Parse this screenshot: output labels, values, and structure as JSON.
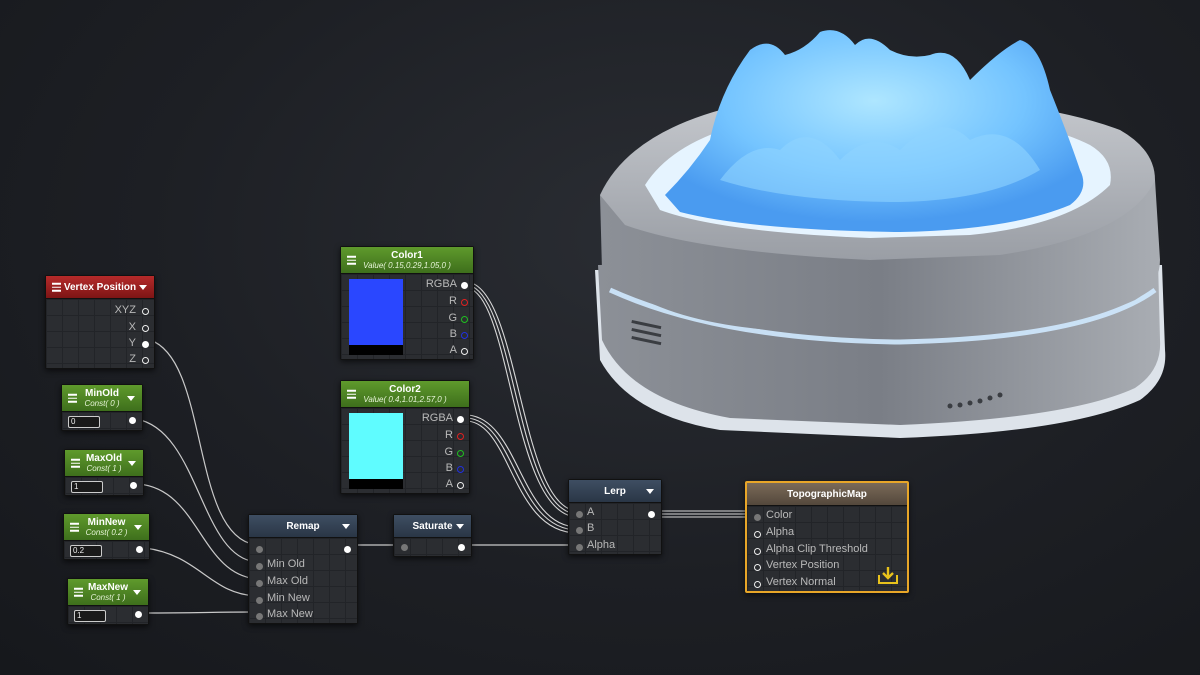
{
  "nodes": {
    "vertex_position": {
      "title": "Vertex Position",
      "outputs": [
        "XYZ",
        "X",
        "Y",
        "Z"
      ]
    },
    "min_old": {
      "title": "MinOld",
      "subtitle": "Const( 0 )",
      "value": "0"
    },
    "max_old": {
      "title": "MaxOld",
      "subtitle": "Const( 1 )",
      "value": "1"
    },
    "min_new": {
      "title": "MinNew",
      "subtitle": "Const( 0.2 )",
      "value": "0.2"
    },
    "max_new": {
      "title": "MaxNew",
      "subtitle": "Const( 1 )",
      "value": "1"
    },
    "color1": {
      "title": "Color1",
      "subtitle": "Value( 0.15,0.29,1.05,0 )",
      "swatch": "#2a47ff",
      "outputs": [
        "RGBA",
        "R",
        "G",
        "B",
        "A"
      ]
    },
    "color2": {
      "title": "Color2",
      "subtitle": "Value( 0.4,1.01,2.57,0 )",
      "swatch": "#5ffcff",
      "outputs": [
        "RGBA",
        "R",
        "G",
        "B",
        "A"
      ]
    },
    "remap": {
      "title": "Remap",
      "inputs": [
        "",
        "Min Old",
        "Max Old",
        "Min New",
        "Max New"
      ]
    },
    "saturate": {
      "title": "Saturate"
    },
    "lerp": {
      "title": "Lerp",
      "inputs": [
        "A",
        "B",
        "Alpha"
      ]
    },
    "topographic_map": {
      "title": "TopographicMap",
      "inputs": [
        "Color",
        "Alpha",
        "Alpha Clip Threshold",
        "Vertex Position",
        "Vertex Normal"
      ]
    }
  },
  "colors": {
    "const_header": "#4f8a25",
    "vertex_header": "#9e2020",
    "op_header": "#34445a",
    "master_header": "#6a5c4e",
    "selection": "#e8a628",
    "terrain": "#6cc8ff"
  }
}
